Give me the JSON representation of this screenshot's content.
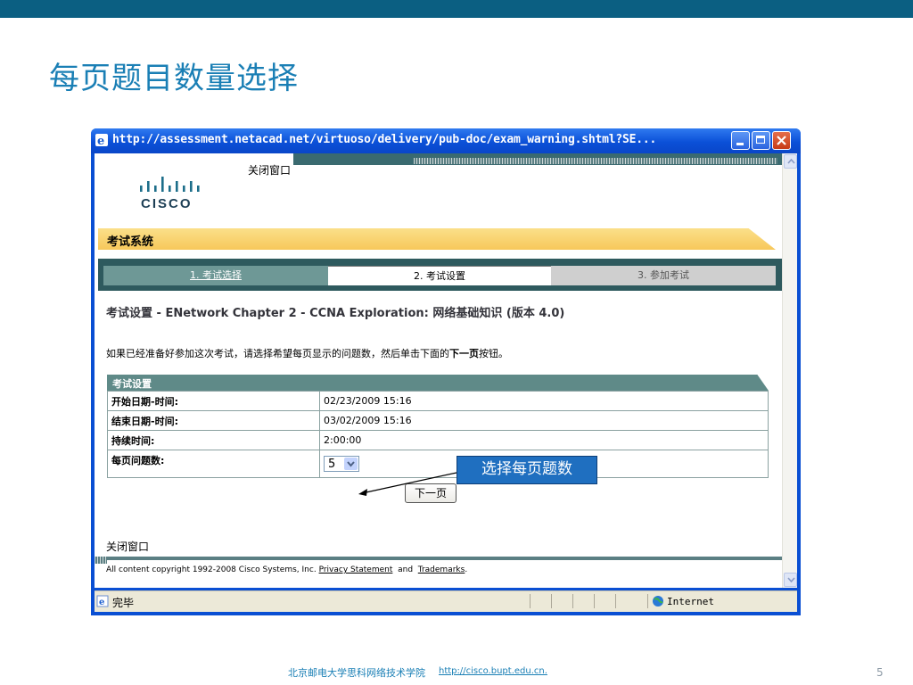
{
  "slide": {
    "title": "每页题目数量选择",
    "footer_text": "北京邮电大学思科网络技术学院",
    "footer_link": "http://cisco.bupt.edu.cn.",
    "page_number": "5"
  },
  "window": {
    "title": "http://assessment.netacad.net/virtuoso/delivery/pub-doc/exam_warning.shtml?SE...",
    "status_text": "完毕",
    "zone_text": "Internet"
  },
  "page": {
    "logo_text": "CISCO",
    "close_window_top": "关闭窗口",
    "system_title": "考试系统",
    "tabs": [
      {
        "label": "1. 考试选择",
        "state": "done"
      },
      {
        "label": "2. 考试设置",
        "state": "active"
      },
      {
        "label": "3. 参加考试",
        "state": "pending"
      }
    ],
    "heading": "考试设置  - ENetwork Chapter 2 - CCNA Exploration: 网络基础知识  (版本  4.0)",
    "instruction_prefix": "如果已经准备好参加这次考试，请选择希望每页显示的问题数，然后单击下面的",
    "instruction_bold": "下一页",
    "instruction_suffix": "按钮。",
    "table_title": "考试设置",
    "rows": [
      {
        "label": "开始日期-时间:",
        "value": "02/23/2009 15:16"
      },
      {
        "label": "结束日期-时间:",
        "value": "03/02/2009 15:16"
      },
      {
        "label": "持续时间:",
        "value": "2:00:00"
      }
    ],
    "per_page_label": "每页问题数:",
    "per_page_value": "5",
    "next_button": "下一页",
    "close_window_bottom": "关闭窗口",
    "copyright_prefix": "All content copyright 1992-2008 Cisco Systems, Inc.",
    "privacy_link": "Privacy Statement",
    "and_text": "and",
    "trademarks_link": "Trademarks",
    "period": "."
  },
  "callout": {
    "text": "选择每页题数"
  },
  "colors": {
    "title_blue": "#1a7fb5",
    "top_bar": "#0b5f82",
    "teal": "#2e5a5e",
    "yellow": "#f7c85a",
    "callout": "#1f6fc0"
  }
}
